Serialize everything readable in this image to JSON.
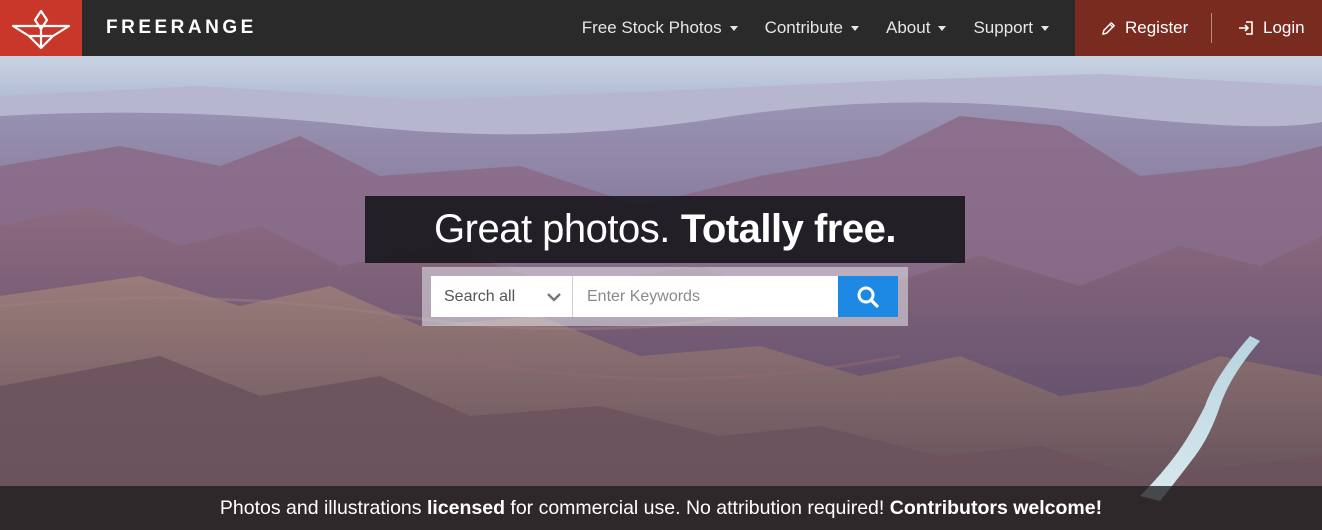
{
  "brand": {
    "name": "FREERANGE",
    "accent": "#c9372a",
    "icon": "freerange-logo-icon"
  },
  "nav": {
    "items": [
      {
        "label": "Free Stock Photos"
      },
      {
        "label": "Contribute"
      },
      {
        "label": "About"
      },
      {
        "label": "Support"
      }
    ],
    "register_label": "Register",
    "login_label": "Login"
  },
  "hero": {
    "headline_light": "Great photos.",
    "headline_bold": "Totally free."
  },
  "search": {
    "category_value": "Search all",
    "placeholder": "Enter Keywords",
    "button_color": "#1e88e5"
  },
  "footer": {
    "part1": "Photos and illustrations ",
    "part2": "licensed",
    "part3": " for commercial use. No attribution required! ",
    "part4": "Contributors welcome!"
  }
}
